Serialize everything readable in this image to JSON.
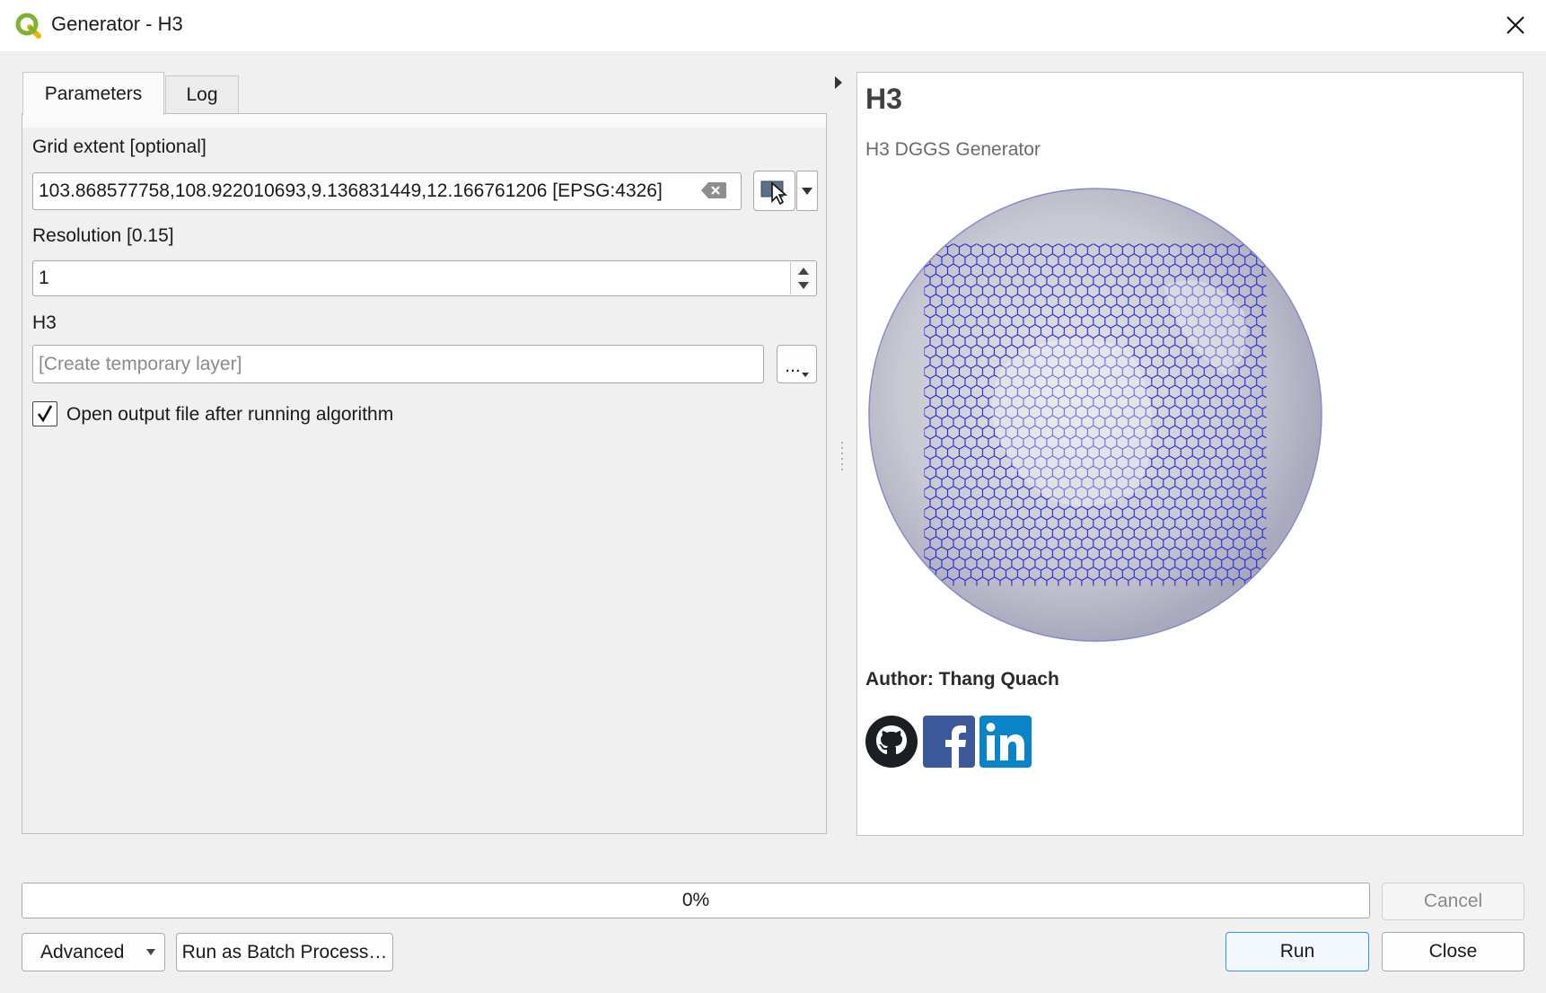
{
  "window": {
    "title": "Generator - H3",
    "app_icon": "qgis-icon",
    "close_icon": "close-icon"
  },
  "tabs": [
    {
      "label": "Parameters",
      "active": true
    },
    {
      "label": "Log",
      "active": false
    }
  ],
  "parameters": {
    "grid_extent": {
      "label": "Grid extent [optional]",
      "value": "103.868577758,108.922010693,9.136831449,12.166761206 [EPSG:4326]",
      "clear_icon": "backspace-clear-icon",
      "map_select_icon": "map-cursor-icon",
      "dropdown_icon": "chevron-down-icon"
    },
    "resolution": {
      "label": "Resolution [0.15]",
      "value": "1",
      "spin_icons": [
        "spin-up-icon",
        "spin-down-icon"
      ]
    },
    "output": {
      "label": "H3",
      "placeholder": "[Create temporary layer]",
      "browse_label": "..."
    },
    "open_after": {
      "label": "Open output file after running algorithm",
      "checked": true
    }
  },
  "help": {
    "title": "H3",
    "subtitle": "H3 DGGS Generator",
    "author": "Author: Thang Quach",
    "social_icons": [
      "github-icon",
      "facebook-icon",
      "linkedin-icon"
    ],
    "colors": {
      "github": "#1b1f23",
      "facebook": "#3b5998",
      "linkedin": "#0a84c8",
      "grid": "#2222dd"
    }
  },
  "progress": {
    "text": "0%",
    "value": 0
  },
  "buttons": {
    "cancel": "Cancel",
    "advanced": "Advanced",
    "batch": "Run as Batch Process…",
    "run": "Run",
    "close": "Close"
  }
}
